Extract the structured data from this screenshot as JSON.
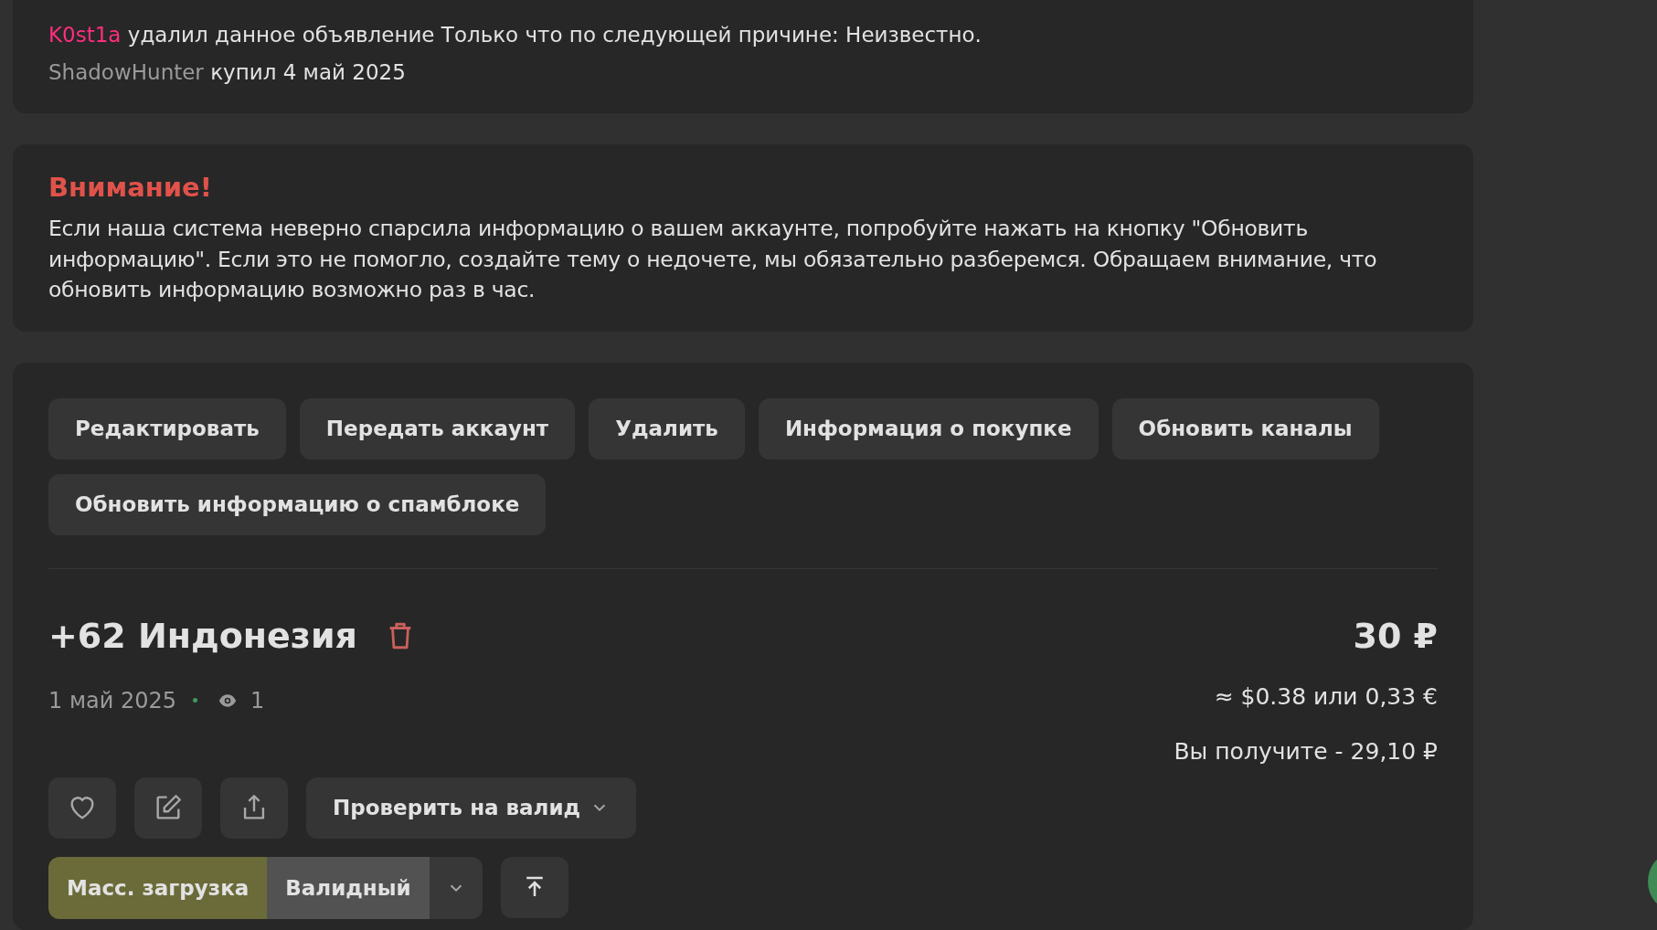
{
  "history": [
    {
      "user": "K0st1a",
      "color": "#ff2e7e",
      "text": "удалил данное объявление Только что по следующей причине: Неизвестно."
    },
    {
      "user": "ShadowHunter",
      "color": "#9a9a9a",
      "text": "купил 4 май 2025"
    }
  ],
  "notice": {
    "title": "Внимание!",
    "text": "Если наша система неверно спарсила информацию о вашем аккаунте, попробуйте нажать на кнопку \"Обновить информацию\". Если это не помогло, создайте тему о недочете, мы обязательно разберемся. Обращаем внимание, что обновить информацию возможно раз в час."
  },
  "actions": [
    "Редактировать",
    "Передать аккаунт",
    "Удалить",
    "Информация о покупке",
    "Обновить каналы",
    "Обновить информацию о спамблоке"
  ],
  "item": {
    "title": "+62 Индонезия",
    "date": "1 май 2025",
    "views": "1",
    "price": "30 ₽",
    "converted": "≈ $0.38 или 0,33 €",
    "you_get": "Вы получите - 29,10 ₽"
  },
  "check_button": "Проверить на валид",
  "segments": [
    {
      "label": "Масс. загрузка",
      "selected": true
    },
    {
      "label": "Валидный",
      "selected": false
    }
  ]
}
